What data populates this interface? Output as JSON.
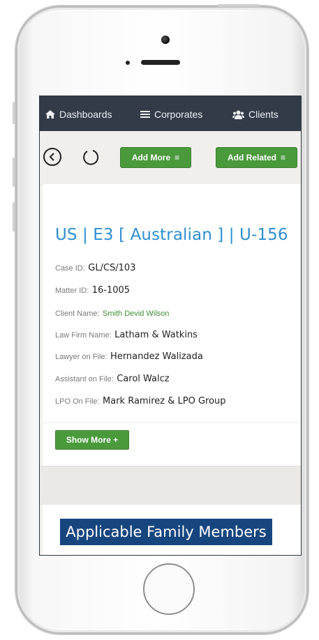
{
  "nav": {
    "items": [
      {
        "label": "Dashboards",
        "icon": "home-icon"
      },
      {
        "label": "Corporates",
        "icon": "bars-icon"
      },
      {
        "label": "Clients",
        "icon": "users-icon"
      }
    ]
  },
  "toolbar": {
    "back_icon": "chevron-left-icon",
    "refresh_icon": "refresh-icon",
    "add_more_label": "Add More",
    "add_related_label": "Add Related",
    "menu_glyph": "≡"
  },
  "case": {
    "title": "US | E3 [ Australian ] | U-156",
    "fields": [
      {
        "label": "Case ID:",
        "value": "GL/CS/103"
      },
      {
        "label": "Matter ID:",
        "value": "16-1005"
      },
      {
        "label": "Client Name:",
        "value": "Smith Devid Wilson"
      },
      {
        "label": "Law Firm Name:",
        "value": "Latham & Watkins"
      },
      {
        "label": "Lawyer on File:",
        "value": "Hernandez Walizada"
      },
      {
        "label": "Assistant on File:",
        "value": "Carol Walcz"
      },
      {
        "label": "LPO On File:",
        "value": "Mark Ramirez & LPO Group"
      }
    ],
    "show_more_label": "Show More +"
  },
  "family": {
    "title": "Applicable Family Members"
  },
  "colors": {
    "navbar": "#333b49",
    "button_green": "#4a9a3c",
    "title_blue": "#2d8fd0",
    "banner_blue": "#17467f",
    "client_green": "#3f8f34"
  }
}
